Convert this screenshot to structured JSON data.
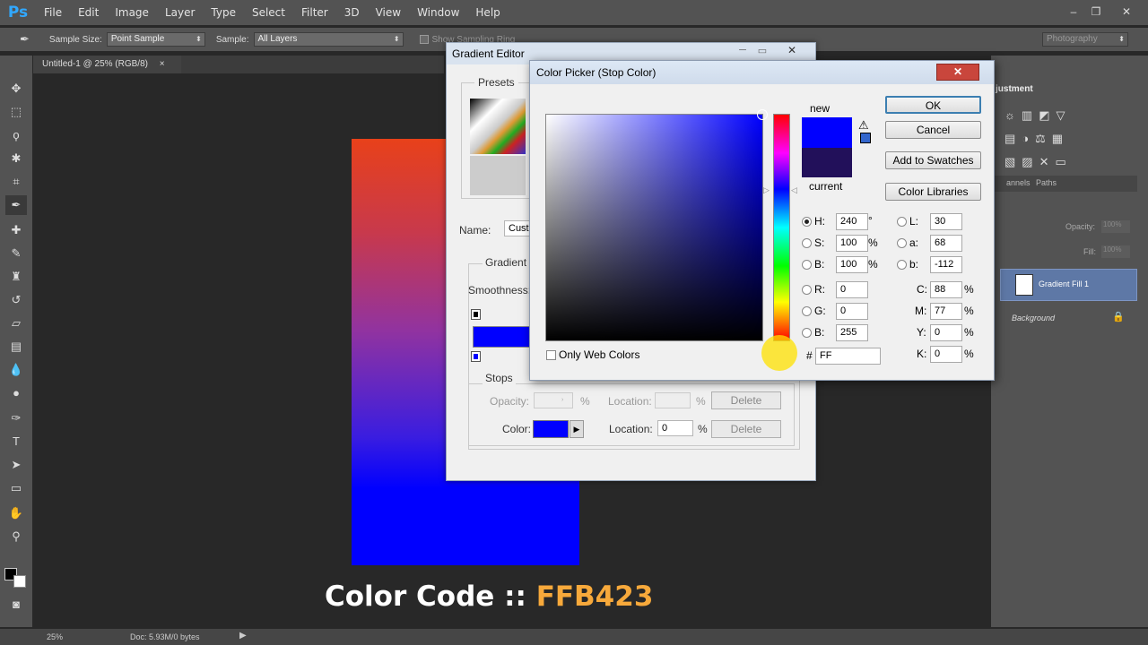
{
  "app": {
    "logo": "Ps"
  },
  "menu": [
    "File",
    "Edit",
    "Image",
    "Layer",
    "Type",
    "Select",
    "Filter",
    "3D",
    "View",
    "Window",
    "Help"
  ],
  "window_controls": {
    "minimize": "–",
    "restore": "❐",
    "close": "✕"
  },
  "options": {
    "sample_size_label": "Sample Size:",
    "sample_size_value": "Point Sample",
    "sample_label": "Sample:",
    "sample_value": "All Layers",
    "show_ring_label": "Show Sampling Ring",
    "workspace": "Photography"
  },
  "document": {
    "tab_title": "Untitled-1 @ 25% (RGB/8)",
    "close": "×"
  },
  "status": {
    "zoom": "25%",
    "doc": "Doc: 5.93M/0 bytes"
  },
  "panels": {
    "adjustments_title": "justment",
    "tab_channels": "annels",
    "tab_paths": "Paths",
    "opacity_label": "Opacity:",
    "opacity_value": "100%",
    "fill_label": "Fill:",
    "fill_value": "100%",
    "layers": [
      {
        "name": "Gradient Fill 1"
      },
      {
        "name": "Background"
      }
    ]
  },
  "gradient_editor": {
    "title": "Gradient Editor",
    "presets_label": "Presets",
    "name_label": "Name:",
    "name_value": "Cust",
    "gradient_type_label": "Gradient",
    "smoothness_label": "Smoothness:",
    "stops_label": "Stops",
    "opacity_label": "Opacity:",
    "opacity_unit": "%",
    "location_label": "Location:",
    "location_unit": "%",
    "delete_label": "Delete",
    "color_label": "Color:",
    "location_value": "0",
    "stop_color": "#0000ff"
  },
  "color_picker": {
    "title": "Color Picker (Stop Color)",
    "close": "✕",
    "new_label": "new",
    "current_label": "current",
    "new_color": "#0000ff",
    "current_color": "#22105a",
    "ok": "OK",
    "cancel": "Cancel",
    "add_swatches": "Add to Swatches",
    "color_libraries": "Color Libraries",
    "fields": {
      "H": "240",
      "S": "100",
      "B": "100",
      "R": "0",
      "G": "0",
      "B2": "255",
      "L": "30",
      "a": "68",
      "b": "-112",
      "C": "88",
      "M": "77",
      "Y": "0",
      "K": "0"
    },
    "degree": "°",
    "percent": "%",
    "hex_label": "#",
    "hex": "FF",
    "web_only": "Only Web Colors"
  },
  "caption": {
    "prefix": "Color Code :: ",
    "code": "FFB423",
    "code_color": "#f7a93b"
  }
}
